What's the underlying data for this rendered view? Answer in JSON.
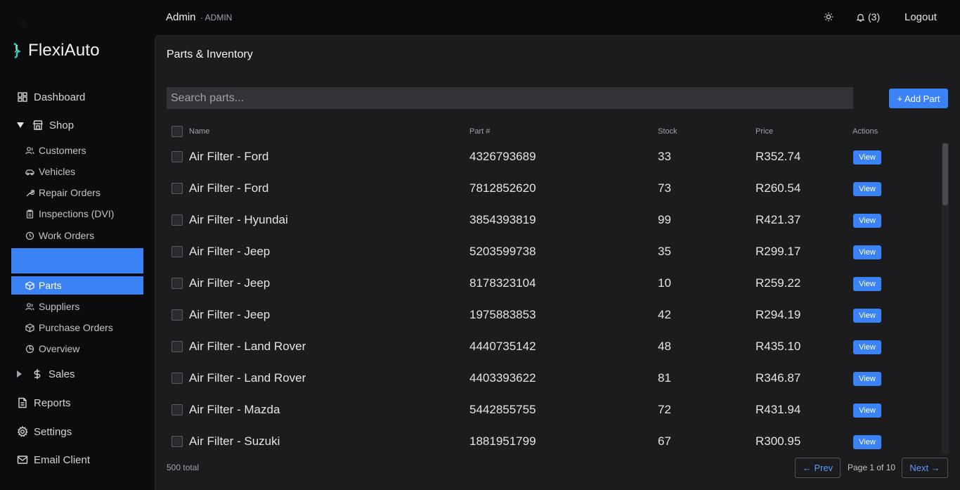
{
  "brand": {
    "name": "FlexiAuto"
  },
  "sidebar": {
    "top_items": [
      {
        "label": "Dashboard",
        "icon": "dashboard-icon"
      },
      {
        "label": "Shop",
        "icon": "store-icon",
        "expanded": true
      }
    ],
    "shop_items": [
      {
        "label": "Customers",
        "icon": "users-icon"
      },
      {
        "label": "Vehicles",
        "icon": "car-icon"
      },
      {
        "label": "Repair Orders",
        "icon": "wrench-icon"
      },
      {
        "label": "Inspections (DVI)",
        "icon": "clipboard-icon"
      },
      {
        "label": "Work Orders",
        "icon": "clock-icon"
      }
    ],
    "parts_items": [
      {
        "label": "Parts",
        "icon": "package-icon",
        "active": true
      },
      {
        "label": "Suppliers",
        "icon": "users-icon"
      },
      {
        "label": "Purchase Orders",
        "icon": "package-icon"
      },
      {
        "label": "Overview",
        "icon": "pie-chart-icon"
      }
    ],
    "bottom_items": [
      {
        "label": "Sales",
        "icon": "dollar-icon"
      },
      {
        "label": "Reports",
        "icon": "document-icon"
      },
      {
        "label": "Settings",
        "icon": "gear-icon"
      },
      {
        "label": "Email Client",
        "icon": "mail-icon"
      }
    ]
  },
  "header": {
    "user_name": "Admin",
    "user_role": "· ADMIN",
    "notifications": "(3)",
    "logout": "Logout"
  },
  "main": {
    "title": "Parts & Inventory",
    "search_placeholder": "Search parts...",
    "add_button": "+ Add Part",
    "columns": [
      "Name",
      "Part #",
      "Stock",
      "Price",
      "Actions"
    ],
    "rows": [
      {
        "name": "Air Filter - Ford",
        "part_no": "4326793689",
        "stock": "33",
        "price": "R352.74",
        "action": "View"
      },
      {
        "name": "Air Filter - Ford",
        "part_no": "7812852620",
        "stock": "73",
        "price": "R260.54",
        "action": "View"
      },
      {
        "name": "Air Filter - Hyundai",
        "part_no": "3854393819",
        "stock": "99",
        "price": "R421.37",
        "action": "View"
      },
      {
        "name": "Air Filter - Jeep",
        "part_no": "5203599738",
        "stock": "35",
        "price": "R299.17",
        "action": "View"
      },
      {
        "name": "Air Filter - Jeep",
        "part_no": "8178323104",
        "stock": "10",
        "price": "R259.22",
        "action": "View"
      },
      {
        "name": "Air Filter - Jeep",
        "part_no": "1975883853",
        "stock": "42",
        "price": "R294.19",
        "action": "View"
      },
      {
        "name": "Air Filter - Land Rover",
        "part_no": "4440735142",
        "stock": "48",
        "price": "R435.10",
        "action": "View"
      },
      {
        "name": "Air Filter - Land Rover",
        "part_no": "4403393622",
        "stock": "81",
        "price": "R346.87",
        "action": "View"
      },
      {
        "name": "Air Filter - Mazda",
        "part_no": "5442855755",
        "stock": "72",
        "price": "R431.94",
        "action": "View"
      },
      {
        "name": "Air Filter - Suzuki",
        "part_no": "1881951799",
        "stock": "67",
        "price": "R300.95",
        "action": "View"
      }
    ],
    "total": "500 total",
    "prev": "← Prev",
    "page_label": "Page 1 of 10",
    "next": "Next →"
  },
  "colors": {
    "accent": "#3b82f6",
    "panel": "#1c1c1f",
    "background": "#0c0c0e"
  }
}
